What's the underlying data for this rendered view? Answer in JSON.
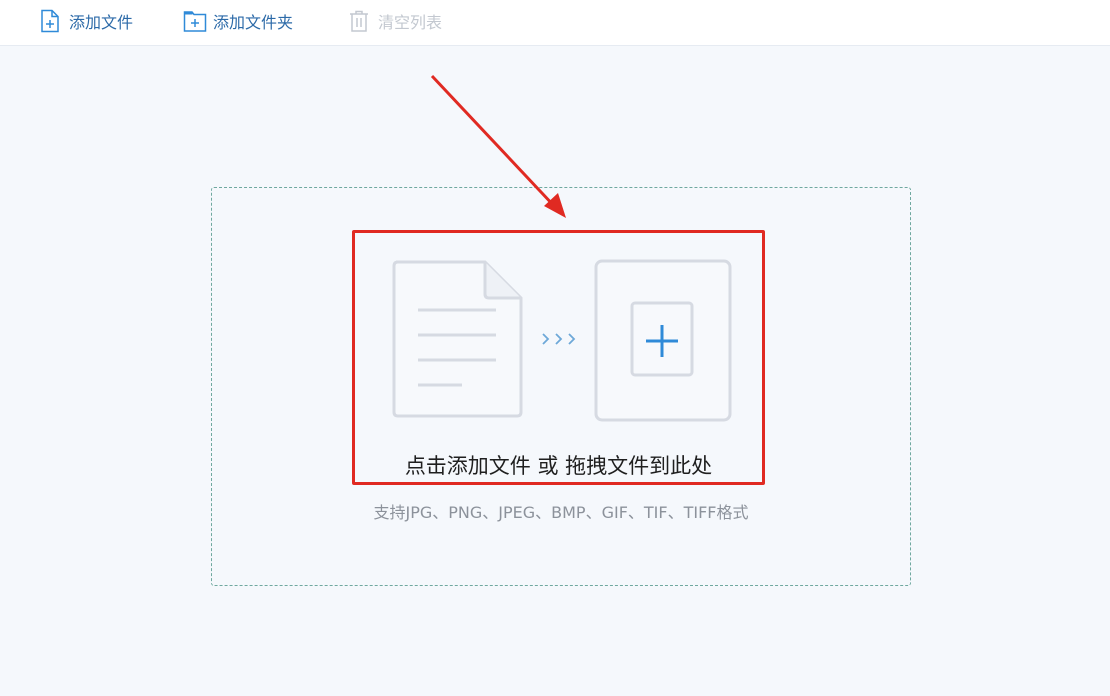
{
  "toolbar": {
    "add_file": {
      "label": "添加文件",
      "icon": "file-plus-icon"
    },
    "add_folder": {
      "label": "添加文件夹",
      "icon": "folder-plus-icon"
    },
    "clear_list": {
      "label": "清空列表",
      "icon": "trash-icon",
      "disabled": true
    }
  },
  "drop_zone": {
    "prompt": "点击添加文件 或 拖拽文件到此处",
    "supported_formats": "支持JPG、PNG、JPEG、BMP、GIF、TIF、TIFF格式",
    "icons": [
      "document-icon",
      "chevrons-right-icon",
      "add-card-icon"
    ]
  },
  "annotation": {
    "color": "#e02a22",
    "type": "red-arrow-and-box"
  },
  "colors": {
    "accent": "#2c6aa8",
    "icon_blue": "#2f8ad8",
    "disabled": "#c3c8d0",
    "background": "#f5f8fc",
    "dashed_border": "#6fa89f"
  }
}
